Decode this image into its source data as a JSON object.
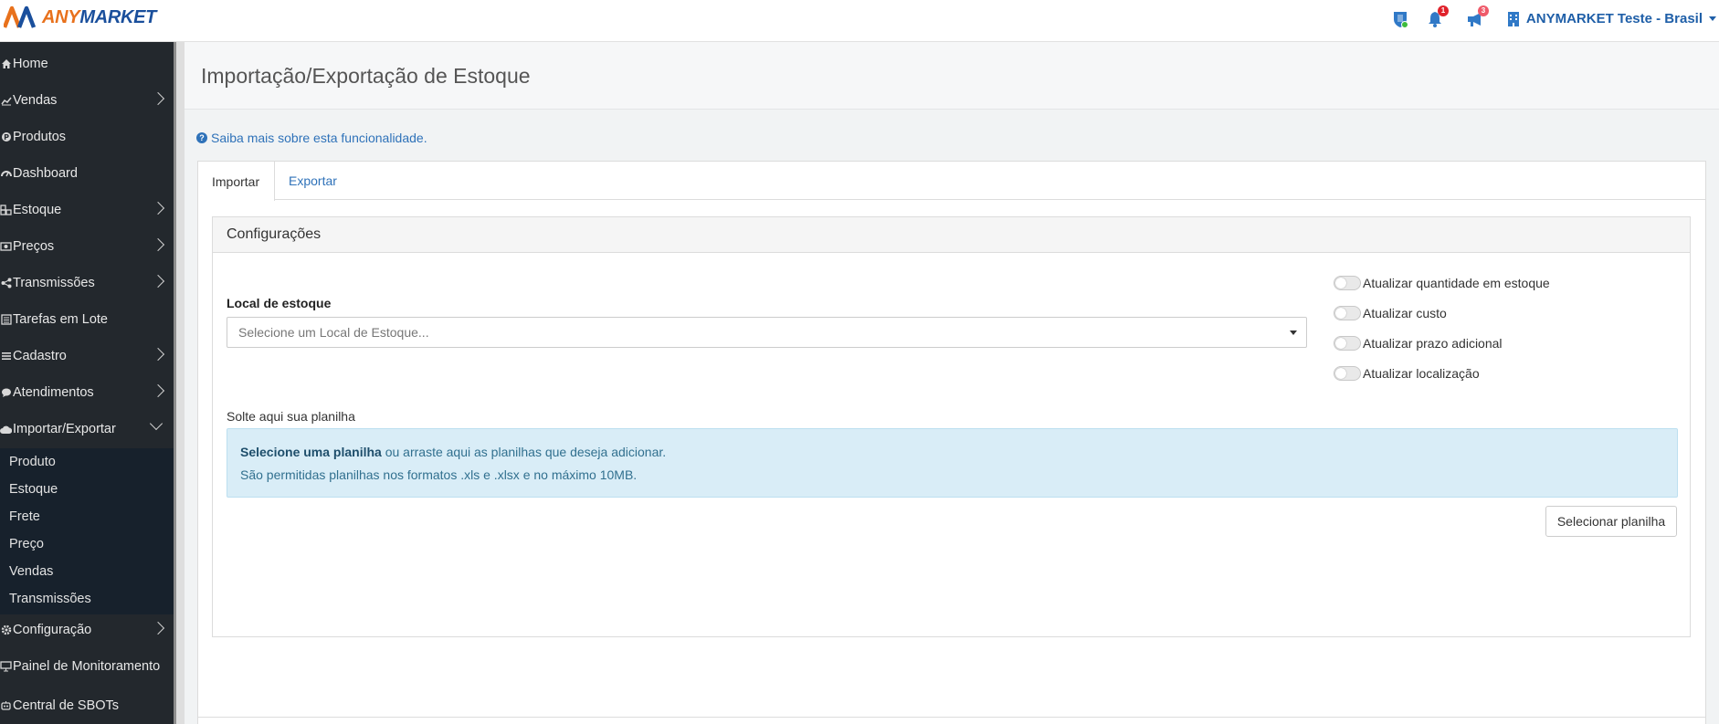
{
  "brand": {
    "logo_text_any": "ANY",
    "logo_text_market": "MARKET"
  },
  "topbar": {
    "notifications_badge": "1",
    "announcements_badge": "3",
    "user_name": "ANYMARKET Teste - Brasil"
  },
  "sidebar": {
    "items": [
      {
        "label": "Home",
        "icon": "home-icon"
      },
      {
        "label": "Vendas",
        "icon": "chart-icon"
      },
      {
        "label": "Produtos",
        "icon": "product-icon"
      },
      {
        "label": "Dashboard",
        "icon": "dashboard-icon"
      },
      {
        "label": "Estoque",
        "icon": "cubes-icon"
      },
      {
        "label": "Preços",
        "icon": "money-icon"
      },
      {
        "label": "Transmissões",
        "icon": "share-icon"
      },
      {
        "label": "Tarefas em Lote",
        "icon": "tasks-icon"
      },
      {
        "label": "Cadastro",
        "icon": "list-icon"
      },
      {
        "label": "Atendimentos",
        "icon": "chat-icon"
      },
      {
        "label": "Importar/Exportar",
        "icon": "cloud-icon"
      },
      {
        "label": "Configuração",
        "icon": "gear-icon"
      },
      {
        "label": "Painel de Monitoramento",
        "icon": "monitor-icon"
      },
      {
        "label": "Central de SBOTs",
        "icon": "bot-icon"
      }
    ],
    "sub_items": [
      "Produto",
      "Estoque",
      "Frete",
      "Preço",
      "Vendas",
      "Transmissões"
    ]
  },
  "page": {
    "title": "Importação/Exportação de Estoque",
    "info_link": "Saiba mais sobre esta funcionalidade.",
    "tabs": [
      "Importar",
      "Exportar"
    ],
    "panel_title": "Configurações",
    "stock_label": "Local de estoque",
    "stock_placeholder": "Selecione um Local de Estoque...",
    "toggles": [
      "Atualizar quantidade em estoque",
      "Atualizar custo",
      "Atualizar prazo adicional",
      "Atualizar localização"
    ],
    "drop_label": "Solte aqui sua planilha",
    "drop_strong": "Selecione uma planilha",
    "drop_rest": " ou arraste aqui as planilhas que deseja adicionar.",
    "drop_formats": "São permitidas planilhas nos formatos .xls e .xlsx e no máximo 10MB.",
    "select_button": "Selecionar planilha"
  },
  "colors": {
    "sidebar_bg": "#23282d",
    "accent_blue": "#2f72b9",
    "logo_orange": "#e8711c",
    "badge_red": "#e0222b"
  }
}
